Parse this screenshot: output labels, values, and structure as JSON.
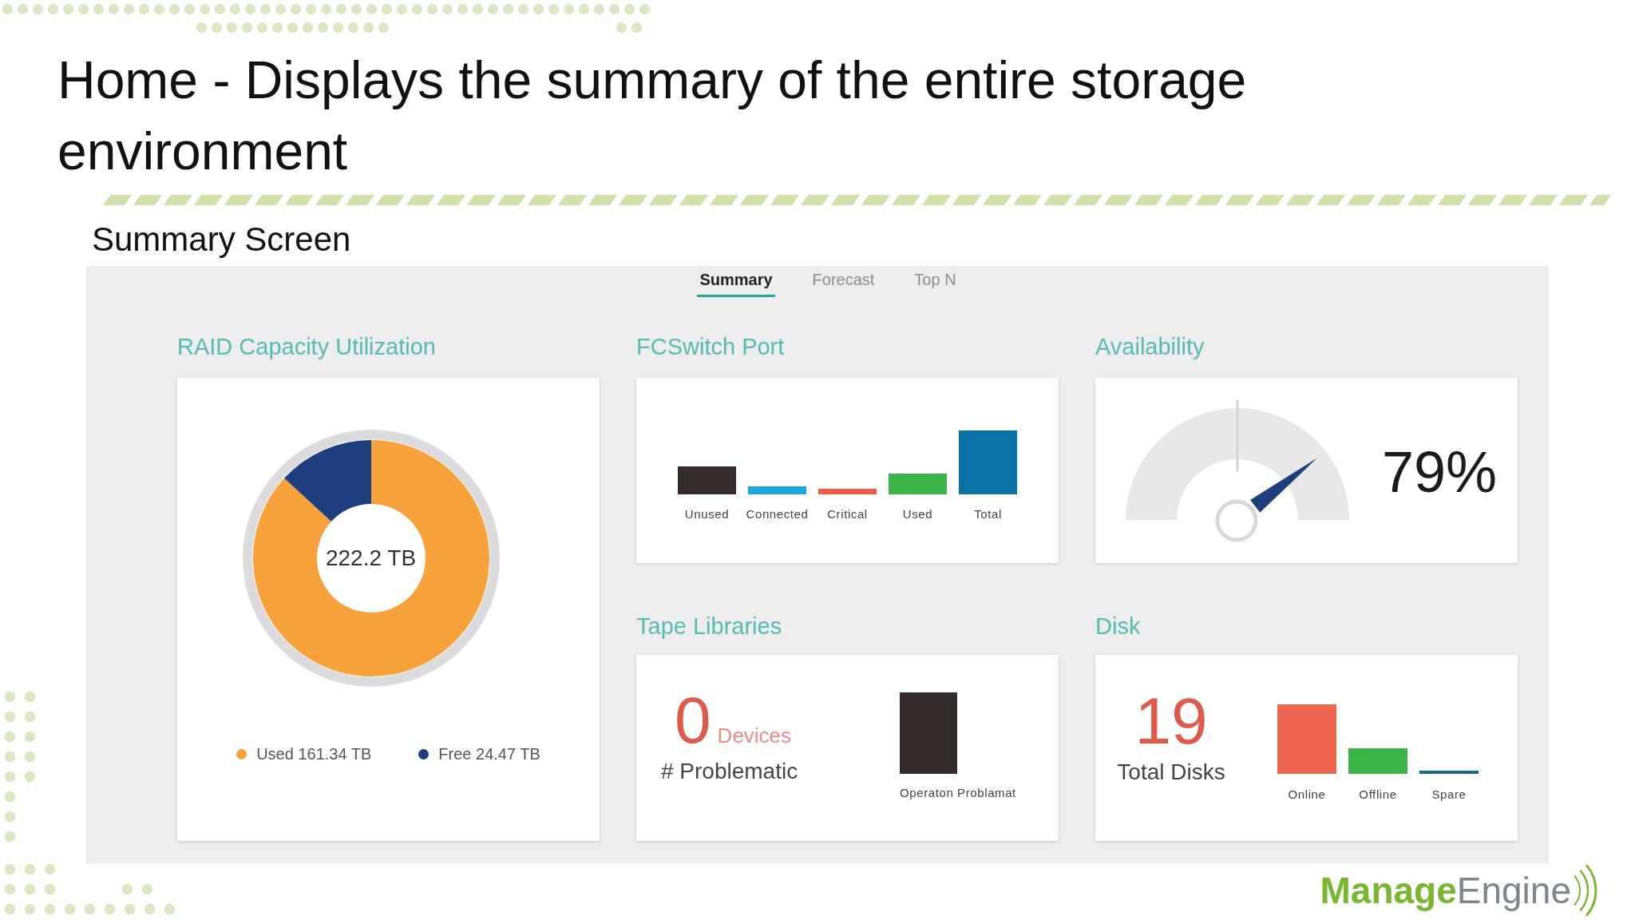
{
  "slide": {
    "title": "Home - Displays the summary of the entire storage environment",
    "subtitle": "Summary Screen"
  },
  "dashboard": {
    "tabs": [
      {
        "label": "Summary",
        "selected": true
      },
      {
        "label": "Forecast",
        "selected": false
      },
      {
        "label": "Top N",
        "selected": false
      }
    ],
    "raid_capacity": {
      "title": "RAID Capacity Utilization",
      "center_label": "222.2 TB",
      "chart_data": {
        "type": "donut",
        "categories": [
          "Used 161.34 TB",
          "Free 24.47 TB"
        ],
        "values": [
          161.34,
          24.47
        ],
        "colors": [
          "#f8a23b",
          "#1e3f7d"
        ]
      }
    },
    "fcswitch_port": {
      "title": "FCSwitch Port",
      "bars": [
        {
          "label": "Unused",
          "color": "#352c2c"
        },
        {
          "label": "Connected",
          "color": "#1ba6dd"
        },
        {
          "label": "Critical",
          "color": "#ef5a45"
        },
        {
          "label": "Used",
          "color": "#3db54a"
        },
        {
          "label": "Total",
          "color": "#0b72a6"
        }
      ]
    },
    "availability": {
      "title": "Availability",
      "level": 0.79,
      "reading": "79%"
    },
    "tape_libraries": {
      "title": "Tape Libraries",
      "count": "0",
      "count_unit": "Devices",
      "caption": "# Problematic",
      "bars": [
        {
          "label": "Operaton Problamat"
        }
      ]
    },
    "disk": {
      "title": "Disk",
      "count": "19",
      "caption": "Total Disks",
      "bars": [
        {
          "label": "Online",
          "color": "#ef6650"
        },
        {
          "label": "Offline",
          "color": "#3cb44a"
        },
        {
          "label": "Spare",
          "color": "#15698f"
        }
      ]
    }
  },
  "logo": {
    "wordmark": "**Manage**Engine"
  }
}
